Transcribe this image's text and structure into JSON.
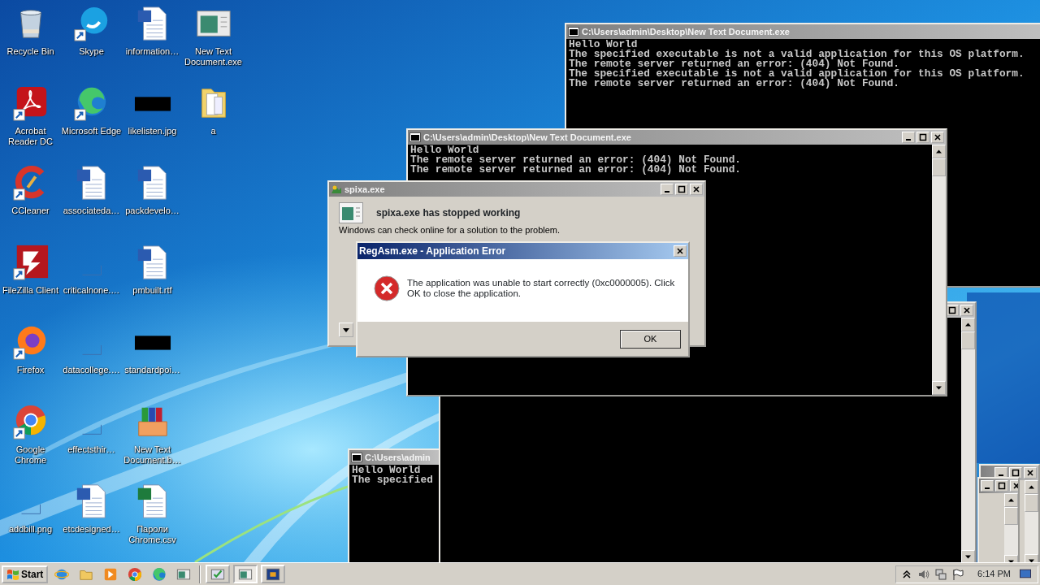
{
  "desktop_icons": [
    {
      "label": "Recycle Bin",
      "kind": "recycle",
      "shortcut": false
    },
    {
      "label": "Acrobat Reader DC",
      "kind": "acrobat",
      "shortcut": true
    },
    {
      "label": "CCleaner",
      "kind": "ccleaner",
      "shortcut": true
    },
    {
      "label": "FileZilla Client",
      "kind": "filezilla",
      "shortcut": true
    },
    {
      "label": "Firefox",
      "kind": "firefox",
      "shortcut": true
    },
    {
      "label": "Google Chrome",
      "kind": "chrome",
      "shortcut": true
    },
    {
      "label": "addbill.png",
      "kind": "blank",
      "shortcut": false
    },
    {
      "label": "Skype",
      "kind": "skype",
      "shortcut": true
    },
    {
      "label": "Microsoft Edge",
      "kind": "edge",
      "shortcut": true
    },
    {
      "label": "associateda…",
      "kind": "word",
      "shortcut": false
    },
    {
      "label": "criticalnone.…",
      "kind": "blank",
      "shortcut": false
    },
    {
      "label": "datacollege.…",
      "kind": "blank",
      "shortcut": false
    },
    {
      "label": "effectsthir…",
      "kind": "blank",
      "shortcut": false
    },
    {
      "label": "etcdesigned…",
      "kind": "word",
      "shortcut": false
    },
    {
      "label": "information…",
      "kind": "word",
      "shortcut": false
    },
    {
      "label": "likelisten.jpg",
      "kind": "dark",
      "shortcut": false
    },
    {
      "label": "packdevelo…",
      "kind": "word",
      "shortcut": false
    },
    {
      "label": "pmbuilt.rtf",
      "kind": "word",
      "shortcut": false
    },
    {
      "label": "standardpoi…",
      "kind": "dark",
      "shortcut": false
    },
    {
      "label": "New Text Document.b…",
      "kind": "archive",
      "shortcut": false
    },
    {
      "label": "Пароли Chrome.csv",
      "kind": "excel",
      "shortcut": false
    },
    {
      "label": "New Text Document.exe",
      "kind": "window",
      "shortcut": false
    },
    {
      "label": "a",
      "kind": "folder",
      "shortcut": false
    }
  ],
  "windows": [
    {
      "kind": "console",
      "title": "C:\\Users\\admin",
      "lines": [
        "Hello World",
        "The specified"
      ],
      "active": false
    },
    {
      "kind": "console",
      "active": false
    },
    {
      "kind": "blank",
      "active": false
    },
    {
      "kind": "blank",
      "active": false
    },
    {
      "kind": "console",
      "title": "C:\\Users\\admin\\Desktop\\New Text Document.exe",
      "lines": [
        "Hello World",
        "The specified executable is not a valid application for this OS platform.",
        "The remote server returned an error: (404) Not Found.",
        "The specified executable is not a valid application for this OS platform.",
        "The remote server returned an error: (404) Not Found."
      ],
      "active": false
    },
    {
      "kind": "console",
      "title": "C:\\Users\\admin\\Desktop\\New Text Document.exe",
      "lines": [
        "Hello World",
        "The remote server returned an error: (404) Not Found.",
        "The remote server returned an error: (404) Not Found."
      ],
      "active": false
    },
    {
      "kind": "report",
      "title": "spixa.exe",
      "heading": "spixa.exe has stopped working",
      "message": "Windows can check online for a solution to the problem.",
      "active": false
    },
    {
      "kind": "error",
      "title": "RegAsm.exe - Application Error",
      "message": "The application was unable to start correctly (0xc0000005). Click OK to close the application.",
      "button": "OK",
      "active": true
    }
  ],
  "taskbar": {
    "start": "Start",
    "quick_launch": [
      {
        "kind": "ie"
      },
      {
        "kind": "folder"
      },
      {
        "kind": "media"
      },
      {
        "kind": "chrome"
      },
      {
        "kind": "edge"
      },
      {
        "kind": "window"
      }
    ],
    "tasks": [
      {
        "kind": "check",
        "selected": false
      },
      {
        "kind": "window",
        "selected": true
      },
      {
        "kind": "flagwin",
        "selected": false
      }
    ],
    "clock": "6:14 PM"
  }
}
